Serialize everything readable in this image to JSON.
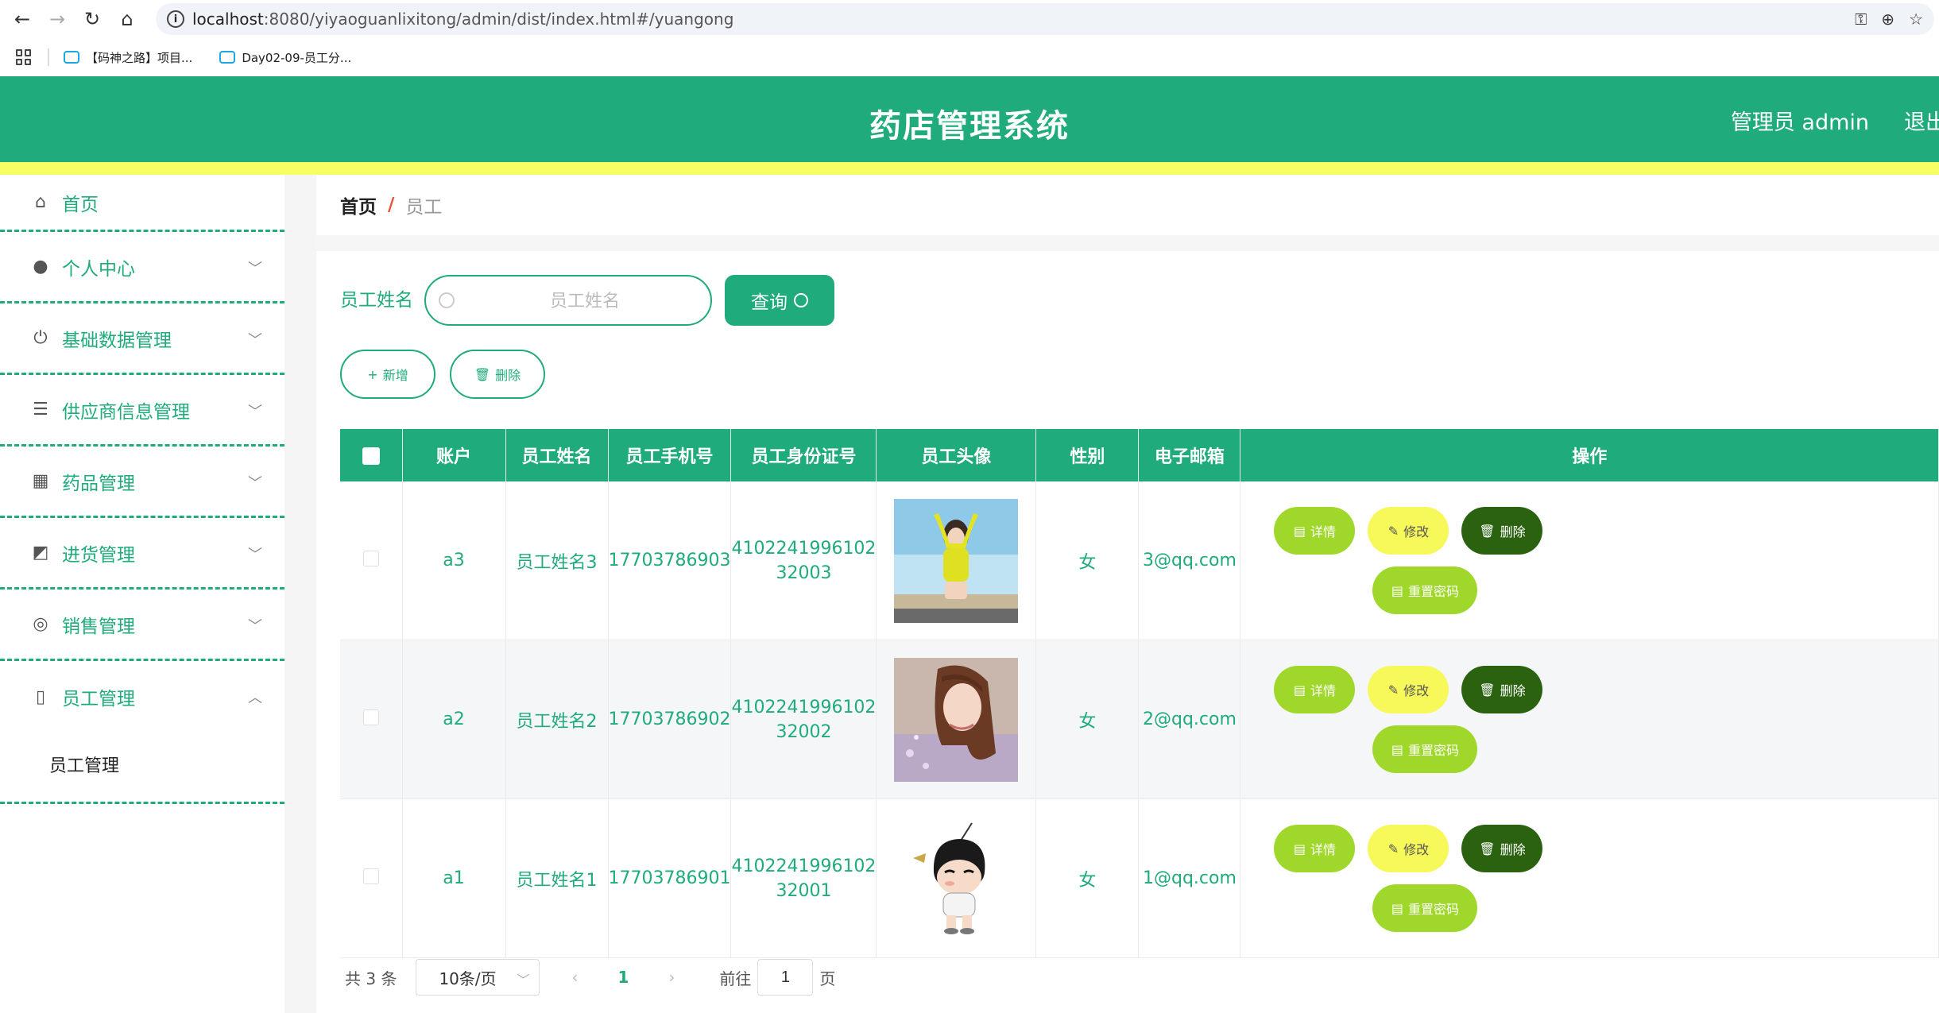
{
  "browser": {
    "url_host": "localhost",
    "url_rest": ":8080/yiyaoguanlixitong/admin/dist/index.html#/yuangong",
    "bookmarks": [
      "【码神之路】项目...",
      "Day02-09-员工分..."
    ]
  },
  "header": {
    "title": "药店管理系统",
    "user": "管理员 admin",
    "logout": "退出"
  },
  "sidebar": {
    "items": [
      {
        "label": "首页",
        "icon": "home-icon"
      },
      {
        "label": "个人中心",
        "icon": "user-icon"
      },
      {
        "label": "基础数据管理",
        "icon": "power-icon"
      },
      {
        "label": "供应商信息管理",
        "icon": "sliders-icon"
      },
      {
        "label": "药品管理",
        "icon": "grid-icon"
      },
      {
        "label": "进货管理",
        "icon": "chart-icon"
      },
      {
        "label": "销售管理",
        "icon": "compass-icon"
      },
      {
        "label": "员工管理",
        "icon": "microphone-icon"
      }
    ],
    "submenu": "员工管理"
  },
  "breadcrumb": {
    "home": "首页",
    "sep": "/",
    "current": "员工"
  },
  "search": {
    "label": "员工姓名",
    "placeholder": "员工姓名",
    "button": "查询"
  },
  "actions": {
    "add": "新增",
    "delete": "删除"
  },
  "table": {
    "headers": [
      "账户",
      "员工姓名",
      "员工手机号",
      "员工身份证号",
      "员工头像",
      "性别",
      "电子邮箱",
      "操作"
    ],
    "rows": [
      {
        "account": "a3",
        "name": "员工姓名3",
        "phone": "17703786903",
        "id_line1": "4102241996102",
        "id_line2": "32003",
        "gender": "女",
        "email": "3@qq.com"
      },
      {
        "account": "a2",
        "name": "员工姓名2",
        "phone": "17703786902",
        "id_line1": "4102241996102",
        "id_line2": "32002",
        "gender": "女",
        "email": "2@qq.com"
      },
      {
        "account": "a1",
        "name": "员工姓名1",
        "phone": "17703786901",
        "id_line1": "4102241996102",
        "id_line2": "32001",
        "gender": "女",
        "email": "1@qq.com"
      }
    ],
    "ops": {
      "detail": "详情",
      "edit": "修改",
      "delete": "删除",
      "reset": "重置密码"
    }
  },
  "pager": {
    "total": "共 3 条",
    "size": "10条/页",
    "page": "1",
    "goto": "前往",
    "goto_value": "1",
    "unit": "页"
  },
  "colors": {
    "primary": "#1fab7b",
    "stripe": "#f8ff62",
    "detail": "#9fd72a",
    "edit": "#f7f95a",
    "delete": "#2a6210"
  }
}
